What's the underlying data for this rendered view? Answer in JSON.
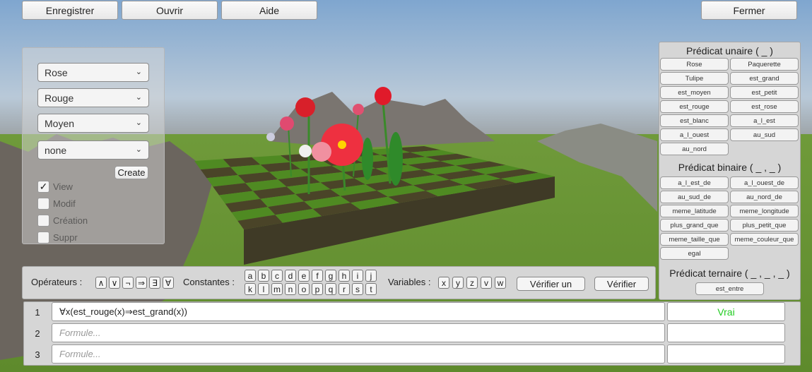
{
  "colors": {
    "vrai": "#22cc22",
    "accent": "#d8d8d8"
  },
  "toolbar": {
    "save": "Enregistrer",
    "open": "Ouvrir",
    "help": "Aide",
    "close": "Fermer"
  },
  "creator": {
    "selects": [
      "Rose",
      "Rouge",
      "Moyen",
      "none"
    ],
    "create": "Create",
    "checkboxes": [
      {
        "label": "View",
        "checked": true
      },
      {
        "label": "Modif",
        "checked": false
      },
      {
        "label": "Création",
        "checked": false
      },
      {
        "label": "Suppr",
        "checked": false
      }
    ]
  },
  "predicates": {
    "unary_title": "Prédicat unaire ( _ )",
    "unary": [
      "Rose",
      "Paquerette",
      "Tulipe",
      "est_grand",
      "est_moyen",
      "est_petit",
      "est_rouge",
      "est_rose",
      "est_blanc",
      "a_l_est",
      "a_l_ouest",
      "au_sud",
      "au_nord"
    ],
    "binary_title": "Prédicat binaire ( _ , _ )",
    "binary": [
      "a_l_est_de",
      "a_l_ouest_de",
      "au_sud_de",
      "au_nord_de",
      "meme_latitude",
      "meme_longitude",
      "plus_grand_que",
      "plus_petit_que",
      "meme_taille_que",
      "meme_couleur_que",
      "egal"
    ],
    "ternary_title": "Prédicat ternaire ( _ , _ , _ )",
    "ternary": [
      "est_entre"
    ]
  },
  "keyboard": {
    "operators_label": "Opérateurs :",
    "operators": [
      "∧",
      "∨",
      "¬",
      "⇒",
      "∃",
      "∀"
    ],
    "constants_label": "Constantes :",
    "constants": [
      "a",
      "b",
      "c",
      "d",
      "e",
      "f",
      "g",
      "h",
      "i",
      "j",
      "k",
      "l",
      "m",
      "n",
      "o",
      "p",
      "q",
      "r",
      "s",
      "t"
    ],
    "variables_label": "Variables :",
    "variables": [
      "x",
      "y",
      "z",
      "v",
      "w"
    ],
    "verify_one": "Vérifier un",
    "verify": "Vérifier"
  },
  "formulas": [
    {
      "num": "1",
      "value": "∀x(est_rouge(x)⇒est_grand(x))",
      "placeholder": "Formule...",
      "result": "Vrai"
    },
    {
      "num": "2",
      "value": "",
      "placeholder": "Formule...",
      "result": ""
    },
    {
      "num": "3",
      "value": "",
      "placeholder": "Formule...",
      "result": ""
    }
  ]
}
